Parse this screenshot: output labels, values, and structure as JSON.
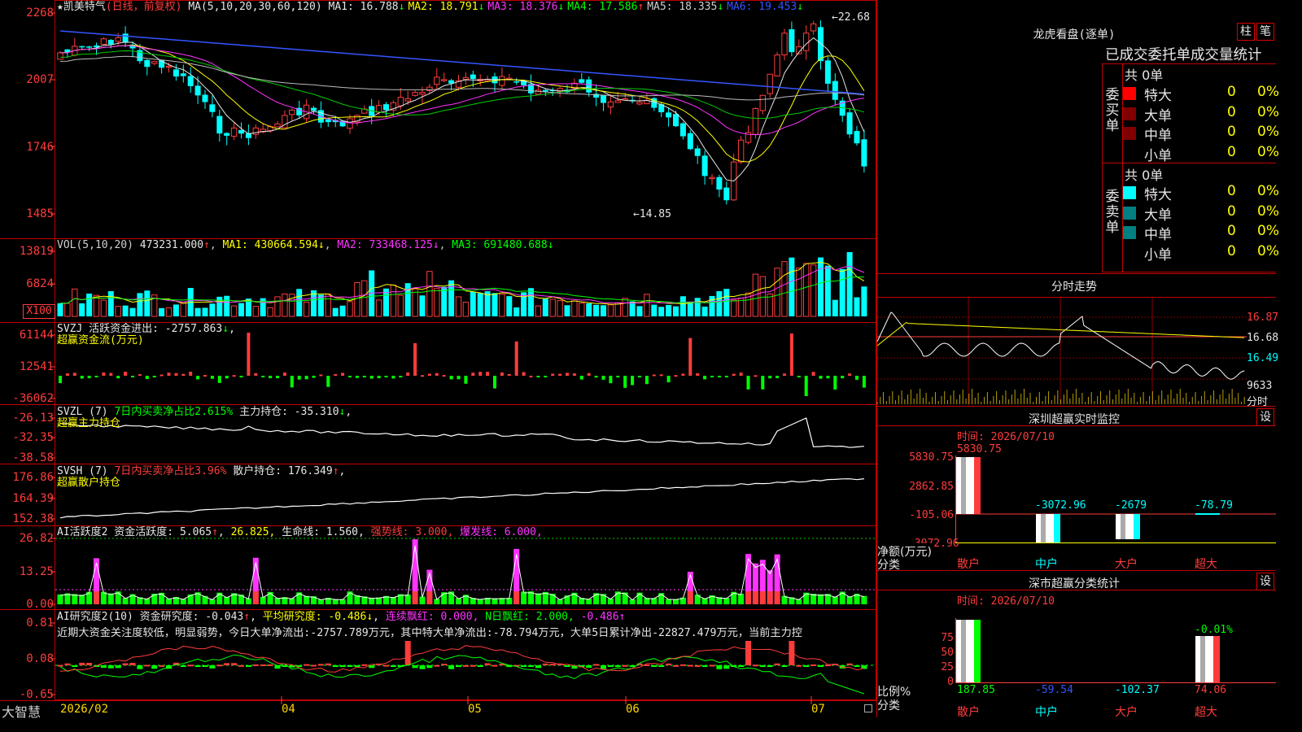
{
  "stock": {
    "name": "凯美特气",
    "mode": "(日线，前复权)",
    "ma_label": "MA(5,10,20,30,60,120)",
    "ma": [
      {
        "name": "MA1:",
        "value": "16.788",
        "arrow": "↓",
        "color": "#e6e6e6"
      },
      {
        "name": "MA2:",
        "value": "18.791",
        "arrow": "↓",
        "color": "#ffff00"
      },
      {
        "name": "MA3:",
        "value": "18.376",
        "arrow": "↓",
        "color": "#ff33ff"
      },
      {
        "name": "MA4:",
        "value": "17.586",
        "arrow": "↑",
        "color": "#00ff00"
      },
      {
        "name": "MA5:",
        "value": "18.335",
        "arrow": "↓",
        "color": "#cfcfcf"
      },
      {
        "name": "MA6:",
        "value": "19.453",
        "arrow": "↓",
        "color": "#3355ff"
      }
    ],
    "high_label": "22.68",
    "low_label": "14.85",
    "price_ticks": [
      "2268",
      "2007",
      "1746",
      "1485"
    ]
  },
  "vol": {
    "title": "VOL(5,10,20)",
    "value": "473231.000",
    "ma1": "MA1: 430664.594",
    "ma2": "MA2: 733468.125",
    "ma3": "MA3: 691480.688",
    "ticks": [
      "13819",
      "6824"
    ],
    "unit": "X100"
  },
  "svzj": {
    "title": "SVZJ  活跃资金进出: -2757.863",
    "sub": "超赢资金流(万元)",
    "ticks": [
      "61144",
      "12541",
      "-36062"
    ]
  },
  "svzl": {
    "title": "SVZL (7)",
    "ratio": "7日内买卖净占比2.615%",
    "hold": "主力持仓: -35.310",
    "sub": "超赢主力持仓",
    "ticks": [
      "-26.13",
      "-32.35",
      "-38.58"
    ]
  },
  "svsh": {
    "title": "SVSH (7)",
    "ratio": "7日内买卖净占比3.96%",
    "hold": "散户持仓: 176.349",
    "sub": "超赢散户持仓",
    "ticks": [
      "176.86",
      "164.39",
      "152.38"
    ]
  },
  "ai1": {
    "title": "AI活跃度2 资金活跃度: 5.065",
    "v2": "26.825,",
    "life": "生命线: 1.560,",
    "strong": "强势线: 3.000,",
    "burst": "爆发线: 6.000,",
    "ticks": [
      "26.82",
      "13.25",
      "0.00"
    ]
  },
  "ai2": {
    "title": "AI研究度2(10) 资金研究度: -0.043",
    "avg": "平均研究度: -0.486",
    "cont": "连续飘红: 0.000,",
    "nday": "N日飘红: 2.000,",
    "last": "-0.486",
    "note": "近期大资金关注度较低，明显弱势，今日大单净流出:-2757.789万元，其中特大单净流出:-78.794万元，大单5日累计净出-22827.479万元，当前主力控",
    "ticks": [
      "0.81",
      "0.08",
      "-0.65"
    ]
  },
  "xaxis": {
    "brand": "大智慧",
    "labels": [
      "2026/02",
      "04",
      "05",
      "06",
      "07"
    ]
  },
  "right": {
    "top_title": "龙虎看盘(逐单)",
    "btn_bar": "柱",
    "btn_pen": "笔",
    "stats_title": "已成交委托单成交量统计",
    "buy": {
      "label": "委买单",
      "total": "共 0单",
      "rows": [
        {
          "name": "特大",
          "value": "0",
          "pct": "0%",
          "color": "#ff0000"
        },
        {
          "name": "大单",
          "value": "0",
          "pct": "0%",
          "color": "#800000"
        },
        {
          "name": "中单",
          "value": "0",
          "pct": "0%",
          "color": "#800000"
        },
        {
          "name": "小单",
          "value": "0",
          "pct": "0%",
          "color": ""
        }
      ]
    },
    "sell": {
      "label": "委卖单",
      "total": "共 0单",
      "rows": [
        {
          "name": "特大",
          "value": "0",
          "pct": "0%",
          "color": "#00ffff"
        },
        {
          "name": "大单",
          "value": "0",
          "pct": "0%",
          "color": "#008080"
        },
        {
          "name": "中单",
          "value": "0",
          "pct": "0%",
          "color": "#008080"
        },
        {
          "name": "小单",
          "value": "0",
          "pct": "0%",
          "color": ""
        }
      ]
    },
    "intraday": {
      "title": "分时走势",
      "ticks": [
        "16.87",
        "16.68",
        "16.49",
        "9633"
      ],
      "foot": "分时"
    },
    "monitor": {
      "title": "深圳超赢实时监控",
      "btn": "设",
      "time": "时间: 2026/07/10",
      "ticks": [
        "5830.75",
        "2862.85",
        "-105.06",
        "-3072.96"
      ],
      "labels": [
        {
          "cat": "散户",
          "value": "5830.75",
          "num": 5830.75
        },
        {
          "cat": "中户",
          "value": "-3072.96",
          "num": -3072.96
        },
        {
          "cat": "大户",
          "value": "-2679",
          "num": -2679
        },
        {
          "cat": "超大",
          "value": "-78.79",
          "num": -78.79
        }
      ],
      "ylabel": "净额(万元)",
      "xlabel": "分类"
    },
    "classify": {
      "title": "深市超赢分类统计",
      "btn": "设",
      "time": "时间: 2026/07/10",
      "ticks": [
        "75",
        "50",
        "25",
        "0"
      ],
      "top_label": "-0.01%",
      "labels": [
        {
          "cat": "散户",
          "value": "187.85"
        },
        {
          "cat": "中户",
          "value": "-59.54"
        },
        {
          "cat": "大户",
          "value": "-102.37"
        },
        {
          "cat": "超大",
          "value": "74.06"
        }
      ],
      "ylabel": "比例%",
      "xlabel": "分类"
    }
  }
}
